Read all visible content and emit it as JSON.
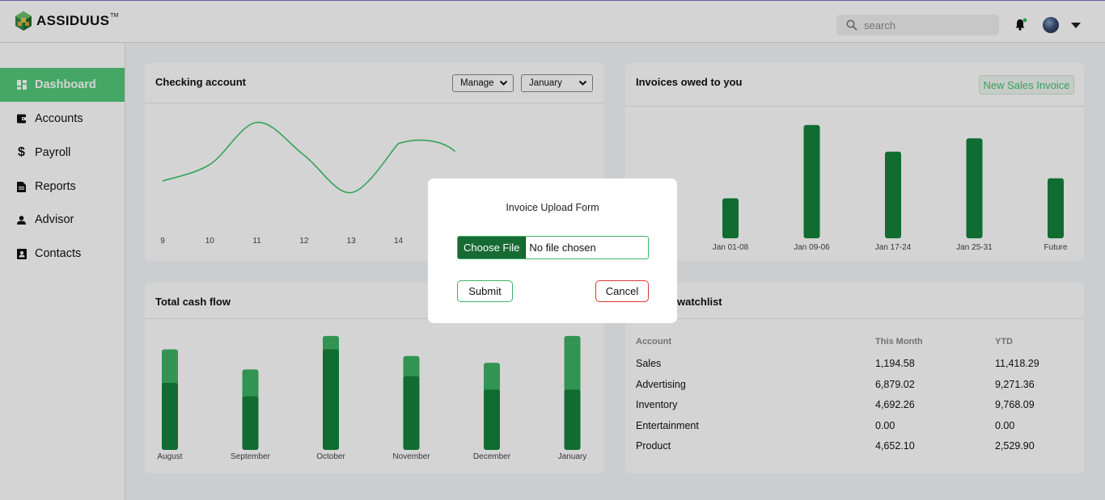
{
  "app": {
    "name": "ASSIDUUS",
    "trademark": "TM"
  },
  "topbar": {
    "search_placeholder": "search"
  },
  "sidebar": {
    "items": [
      {
        "label": "Dashboard",
        "icon": "dashboard-icon",
        "active": true
      },
      {
        "label": "Accounts",
        "icon": "wallet-icon",
        "active": false
      },
      {
        "label": "Payroll",
        "icon": "dollar-icon",
        "active": false
      },
      {
        "label": "Reports",
        "icon": "document-icon",
        "active": false
      },
      {
        "label": "Advisor",
        "icon": "person-icon",
        "active": false
      },
      {
        "label": "Contacts",
        "icon": "contact-book-icon",
        "active": false
      }
    ]
  },
  "checking": {
    "title": "Checking account",
    "manage_select": "Manage",
    "month_select": "January"
  },
  "invoices": {
    "title": "Invoices owed to you",
    "new_button": "New Sales Invoice"
  },
  "cashflow": {
    "title": "Total cash flow"
  },
  "watchlist": {
    "title": "watchlist",
    "columns": [
      "Account",
      "This Month",
      "YTD"
    ],
    "rows": [
      {
        "account": "Sales",
        "month": "1,194.58",
        "ytd": "11,418.29"
      },
      {
        "account": "Advertising",
        "month": "6,879.02",
        "ytd": "9,271.36"
      },
      {
        "account": "Inventory",
        "month": "4,692.26",
        "ytd": "9,768.09"
      },
      {
        "account": "Entertainment",
        "month": "0.00",
        "ytd": "0.00"
      },
      {
        "account": "Product",
        "month": "4,652.10",
        "ytd": "2,529.90"
      }
    ]
  },
  "modal": {
    "title": "Invoice Upload Form",
    "choose_label": "Choose File",
    "file_status": "No file chosen",
    "submit_label": "Submit",
    "cancel_label": "Cancel"
  },
  "colors": {
    "accent": "#52c97a",
    "bar_dark": "#15823b",
    "bar_light": "#3db364",
    "line": "#3ec46a",
    "submit_border": "#3bb365",
    "cancel_border": "#d93a3a"
  },
  "chart_data": [
    {
      "type": "line",
      "x": [
        "9",
        "10",
        "11",
        "12",
        "13",
        "14"
      ],
      "tick_labels": [
        "9",
        "10",
        "11",
        "12",
        "13",
        "14"
      ],
      "values": [
        1.0,
        1.7,
        3.5,
        2.1,
        0.5,
        2.6
      ],
      "grid": false
    },
    {
      "type": "bar",
      "categories": [
        "Jan 01-08",
        "Jan 09-06",
        "Jan 17-24",
        "Jan 25-31",
        "Future"
      ],
      "values": [
        3.0,
        8.5,
        6.5,
        7.5,
        4.5
      ],
      "grid": false
    },
    {
      "type": "bar",
      "stacked": true,
      "categories": [
        "August",
        "September",
        "October",
        "November",
        "December",
        "January"
      ],
      "series": [
        {
          "values": [
            5.0,
            4.0,
            7.5,
            5.5,
            4.5,
            4.5
          ]
        },
        {
          "values": [
            2.5,
            2.0,
            1.0,
            1.5,
            2.0,
            4.0
          ]
        }
      ],
      "grid": false
    }
  ]
}
